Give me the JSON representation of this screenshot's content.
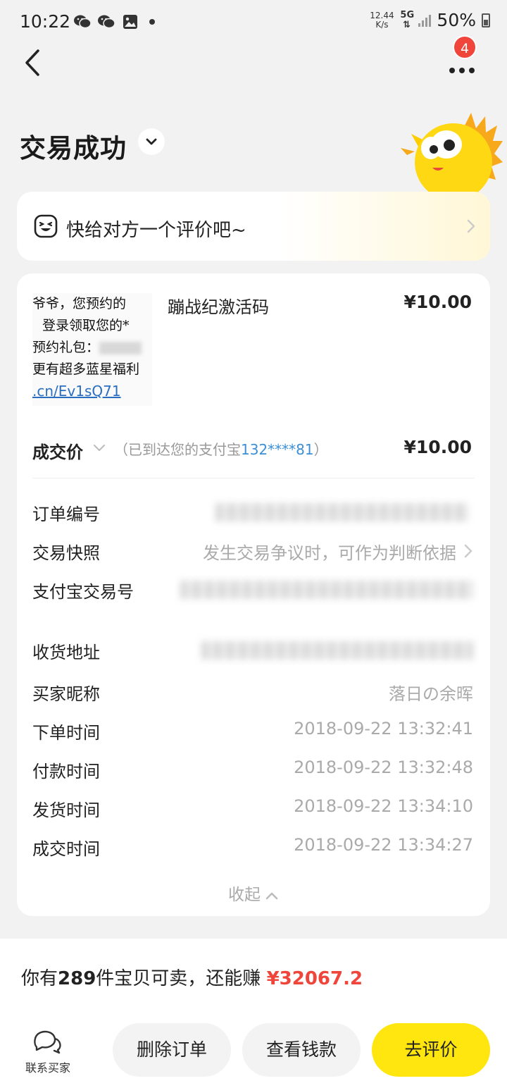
{
  "status_bar": {
    "time": "10:22",
    "speed_value": "12.44",
    "speed_unit": "K/s",
    "network": "5G",
    "battery": "50%"
  },
  "nav": {
    "more_badge": "4"
  },
  "header": {
    "status_title": "交易成功"
  },
  "review_prompt": {
    "text": "快给对方一个评价吧~"
  },
  "order": {
    "thumbnail_lines": [
      "爷爷，您预约的",
      "登录领取您的*",
      "预约礼包：",
      "更有超多蓝星福利",
      ".cn/Ev1sQ71"
    ],
    "item_title": "蹦战纪激活码",
    "item_price": "¥10.00",
    "deal_label": "成交价",
    "deal_note_prefix": "（已到达您的支付宝",
    "deal_note_account": "132****81",
    "deal_note_suffix": "）",
    "deal_price": "¥10.00",
    "details": {
      "order_no_label": "订单编号",
      "snapshot_label": "交易快照",
      "snapshot_value": "发生交易争议时，可作为判断依据",
      "alipay_no_label": "支付宝交易号",
      "address_label": "收货地址",
      "buyer_label": "买家昵称",
      "buyer_value": "落日の余晖",
      "order_time_label": "下单时间",
      "order_time_value": "2018-09-22 13:32:41",
      "pay_time_label": "付款时间",
      "pay_time_value": "2018-09-22 13:32:48",
      "ship_time_label": "发货时间",
      "ship_time_value": "2018-09-22 13:34:10",
      "deal_time_label": "成交时间",
      "deal_time_value": "2018-09-22 13:34:27"
    },
    "collapse_label": "收起"
  },
  "bottom": {
    "earn_prefix": "你有",
    "earn_count": "289",
    "earn_middle": "件宝贝可卖，还能赚 ",
    "earn_amount": "¥32067.2",
    "contact_label": "联系买家",
    "delete_label": "删除订单",
    "money_label": "查看钱款",
    "review_label": "去评价"
  },
  "colors": {
    "accent_yellow": "#ffe60f",
    "price_red": "#f0453a",
    "link_blue": "#3a8fd6"
  },
  "icons": [
    "wechat-icon",
    "wechat-icon",
    "image-icon",
    "signal-icon",
    "battery-icon",
    "back-arrow-icon",
    "more-dots-icon",
    "chevron-down-icon",
    "smile-face-icon",
    "chevron-right-icon",
    "chevron-up-icon",
    "chat-bubbles-icon"
  ]
}
